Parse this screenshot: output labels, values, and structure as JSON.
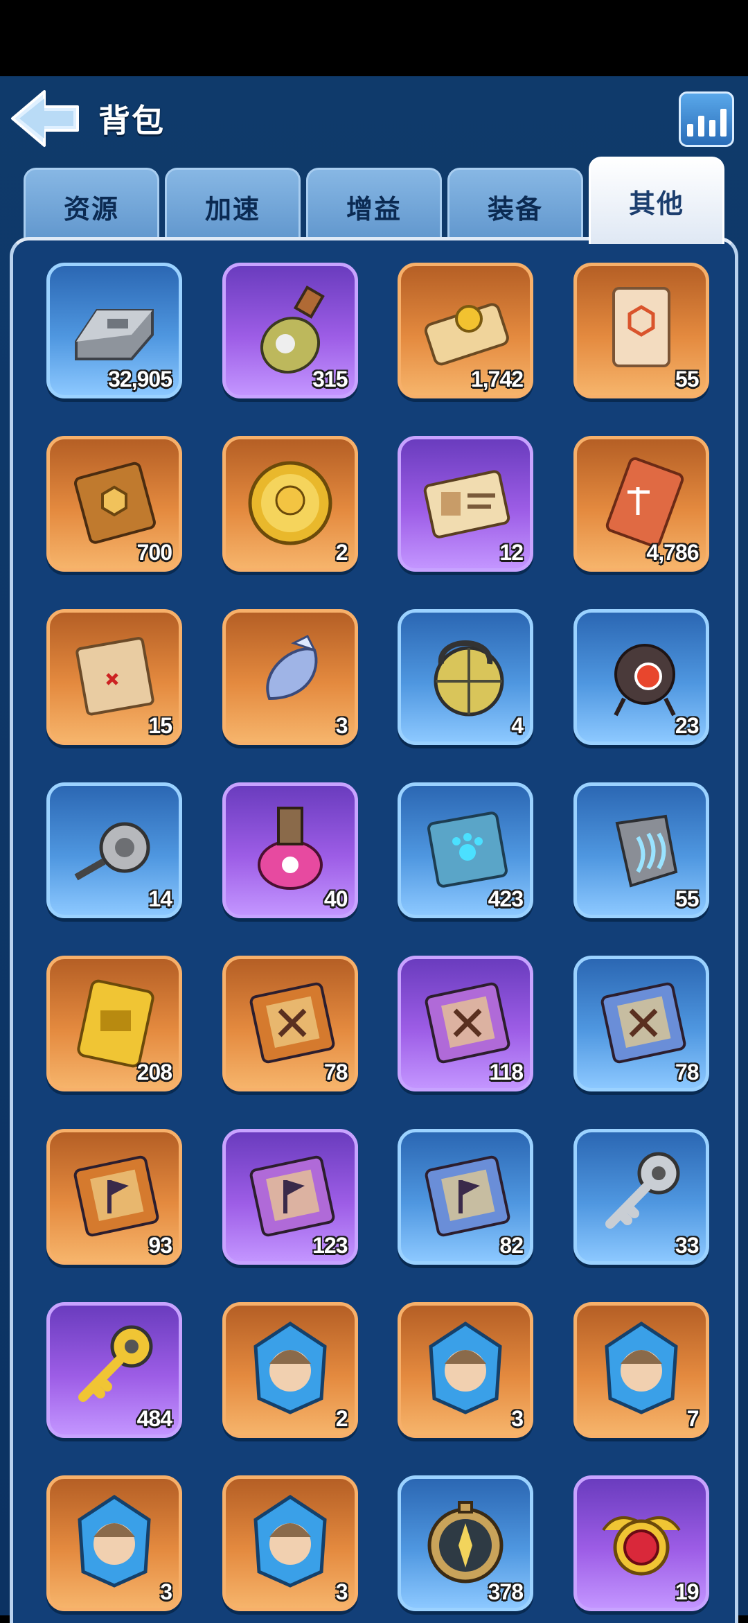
{
  "header": {
    "title": "背包"
  },
  "tabs": [
    {
      "label": "资源",
      "active": false
    },
    {
      "label": "加速",
      "active": false
    },
    {
      "label": "增益",
      "active": false
    },
    {
      "label": "装备",
      "active": false
    },
    {
      "label": "其他",
      "active": true
    }
  ],
  "colors": {
    "orange": "#e48a3f",
    "purple": "#9d5de6",
    "blue": "#4f97e0",
    "background": "#0f3a6b"
  },
  "items": [
    {
      "icon": "silver-ingot-icon",
      "quantity": "32,905",
      "rarity": "blue"
    },
    {
      "icon": "potion-bottle-icon",
      "quantity": "315",
      "rarity": "purple"
    },
    {
      "icon": "scroll-with-seal-icon",
      "quantity": "1,742",
      "rarity": "orange"
    },
    {
      "icon": "paper-scroll-icon",
      "quantity": "55",
      "rarity": "orange"
    },
    {
      "icon": "gem-book-icon",
      "quantity": "700",
      "rarity": "orange"
    },
    {
      "icon": "gold-coin-icon",
      "quantity": "2",
      "rarity": "orange"
    },
    {
      "icon": "id-card-icon",
      "quantity": "12",
      "rarity": "purple"
    },
    {
      "icon": "scales-ticket-icon",
      "quantity": "4,786",
      "rarity": "orange"
    },
    {
      "icon": "treasure-map-icon",
      "quantity": "15",
      "rarity": "orange"
    },
    {
      "icon": "crystal-shard-icon",
      "quantity": "3",
      "rarity": "orange"
    },
    {
      "icon": "cage-lantern-icon",
      "quantity": "4",
      "rarity": "blue"
    },
    {
      "icon": "robot-drone-icon",
      "quantity": "23",
      "rarity": "blue"
    },
    {
      "icon": "fishing-reel-icon",
      "quantity": "14",
      "rarity": "blue"
    },
    {
      "icon": "paw-potion-icon",
      "quantity": "40",
      "rarity": "purple"
    },
    {
      "icon": "paw-book-icon",
      "quantity": "423",
      "rarity": "blue"
    },
    {
      "icon": "claw-stone-icon",
      "quantity": "55",
      "rarity": "blue"
    },
    {
      "icon": "gold-ticket-icon",
      "quantity": "208",
      "rarity": "orange"
    },
    {
      "icon": "swords-book-orange-icon",
      "quantity": "78",
      "rarity": "orange"
    },
    {
      "icon": "swords-book-purple-icon",
      "quantity": "118",
      "rarity": "purple"
    },
    {
      "icon": "swords-book-blue-icon",
      "quantity": "78",
      "rarity": "blue"
    },
    {
      "icon": "flag-book-orange-icon",
      "quantity": "93",
      "rarity": "orange"
    },
    {
      "icon": "flag-book-purple-icon",
      "quantity": "123",
      "rarity": "purple"
    },
    {
      "icon": "flag-book-blue-icon",
      "quantity": "82",
      "rarity": "blue"
    },
    {
      "icon": "silver-key-icon",
      "quantity": "33",
      "rarity": "blue"
    },
    {
      "icon": "gold-key-icon",
      "quantity": "484",
      "rarity": "purple"
    },
    {
      "icon": "pirate-emblem-crystal-icon",
      "quantity": "2",
      "rarity": "orange"
    },
    {
      "icon": "blonde-hero-crystal-icon",
      "quantity": "3",
      "rarity": "orange"
    },
    {
      "icon": "grey-hair-hero-crystal-icon",
      "quantity": "7",
      "rarity": "orange"
    },
    {
      "icon": "bearded-hero-crystal-icon",
      "quantity": "3",
      "rarity": "orange"
    },
    {
      "icon": "old-hero-crystal-icon",
      "quantity": "3",
      "rarity": "orange"
    },
    {
      "icon": "compass-icon",
      "quantity": "378",
      "rarity": "blue"
    },
    {
      "icon": "ruby-amulet-icon",
      "quantity": "19",
      "rarity": "purple"
    }
  ]
}
